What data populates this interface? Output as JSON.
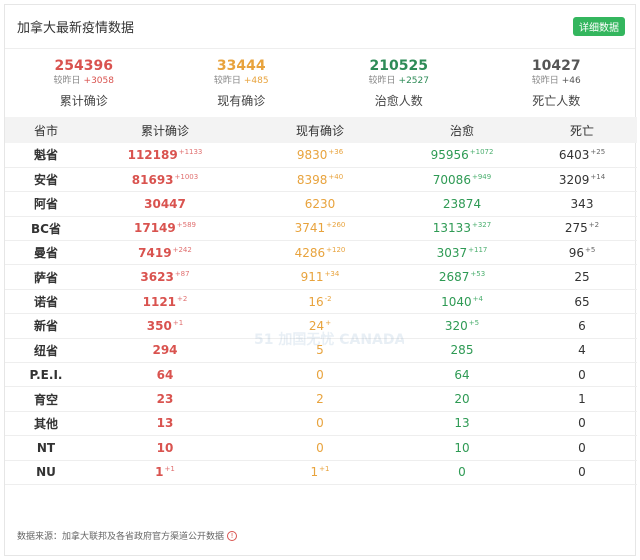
{
  "header": {
    "title": "加拿大最新疫情数据",
    "detail_label": "详细数据"
  },
  "summary": [
    {
      "value": "254396",
      "delta_label": "较昨日",
      "delta": "+3058",
      "label": "累计确诊",
      "color": "#d9534f"
    },
    {
      "value": "33444",
      "delta_label": "较昨日",
      "delta": "+485",
      "label": "现有确诊",
      "color": "#e8a33d"
    },
    {
      "value": "210525",
      "delta_label": "较昨日",
      "delta": "+2527",
      "label": "治愈人数",
      "color": "#2e8b57"
    },
    {
      "value": "10427",
      "delta_label": "较昨日",
      "delta": "+46",
      "label": "死亡人数",
      "color": "#555555"
    }
  ],
  "table": {
    "headers": [
      "省市",
      "累计确诊",
      "现有确诊",
      "治愈",
      "死亡"
    ],
    "rows": [
      {
        "prov": "魁省",
        "conf": "112189",
        "conf_inc": "+1133",
        "active": "9830",
        "active_inc": "+36",
        "cured": "95956",
        "cured_inc": "+1072",
        "dead": "6403",
        "dead_inc": "+25"
      },
      {
        "prov": "安省",
        "conf": "81693",
        "conf_inc": "+1003",
        "active": "8398",
        "active_inc": "+40",
        "cured": "70086",
        "cured_inc": "+949",
        "dead": "3209",
        "dead_inc": "+14"
      },
      {
        "prov": "阿省",
        "conf": "30447",
        "conf_inc": "",
        "active": "6230",
        "active_inc": "",
        "cured": "23874",
        "cured_inc": "",
        "dead": "343",
        "dead_inc": ""
      },
      {
        "prov": "BC省",
        "conf": "17149",
        "conf_inc": "+589",
        "active": "3741",
        "active_inc": "+260",
        "cured": "13133",
        "cured_inc": "+327",
        "dead": "275",
        "dead_inc": "+2"
      },
      {
        "prov": "曼省",
        "conf": "7419",
        "conf_inc": "+242",
        "active": "4286",
        "active_inc": "+120",
        "cured": "3037",
        "cured_inc": "+117",
        "dead": "96",
        "dead_inc": "+5"
      },
      {
        "prov": "萨省",
        "conf": "3623",
        "conf_inc": "+87",
        "active": "911",
        "active_inc": "+34",
        "cured": "2687",
        "cured_inc": "+53",
        "dead": "25",
        "dead_inc": ""
      },
      {
        "prov": "诺省",
        "conf": "1121",
        "conf_inc": "+2",
        "active": "16",
        "active_inc": "-2",
        "cured": "1040",
        "cured_inc": "+4",
        "dead": "65",
        "dead_inc": ""
      },
      {
        "prov": "新省",
        "conf": "350",
        "conf_inc": "+1",
        "active": "24",
        "active_inc": "+",
        "cured": "320",
        "cured_inc": "+5",
        "dead": "6",
        "dead_inc": ""
      },
      {
        "prov": "纽省",
        "conf": "294",
        "conf_inc": "",
        "active": "5",
        "active_inc": "",
        "cured": "285",
        "cured_inc": "",
        "dead": "4",
        "dead_inc": ""
      },
      {
        "prov": "P.E.I.",
        "conf": "64",
        "conf_inc": "",
        "active": "0",
        "active_inc": "",
        "cured": "64",
        "cured_inc": "",
        "dead": "0",
        "dead_inc": ""
      },
      {
        "prov": "育空",
        "conf": "23",
        "conf_inc": "",
        "active": "2",
        "active_inc": "",
        "cured": "20",
        "cured_inc": "",
        "dead": "1",
        "dead_inc": ""
      },
      {
        "prov": "其他",
        "conf": "13",
        "conf_inc": "",
        "active": "0",
        "active_inc": "",
        "cured": "13",
        "cured_inc": "",
        "dead": "0",
        "dead_inc": ""
      },
      {
        "prov": "NT",
        "conf": "10",
        "conf_inc": "",
        "active": "0",
        "active_inc": "",
        "cured": "10",
        "cured_inc": "",
        "dead": "0",
        "dead_inc": ""
      },
      {
        "prov": "NU",
        "conf": "1",
        "conf_inc": "+1",
        "active": "1",
        "active_inc": "+1",
        "cured": "0",
        "cured_inc": "",
        "dead": "0",
        "dead_inc": ""
      }
    ]
  },
  "footer": {
    "source": "数据来源：加拿大联邦及各省政府官方渠道公开数据",
    "icon": "info-icon"
  },
  "watermark": {
    "icon": "logo-watermark",
    "text": "51 加国无忧 CANADA"
  }
}
